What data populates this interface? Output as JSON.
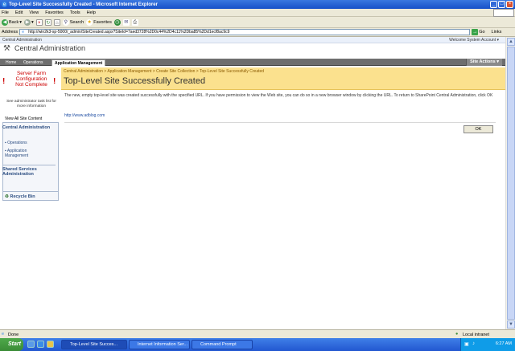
{
  "window": {
    "title": "Top-Level Site Successfully Created - Microsoft Internet Explorer"
  },
  "menu": [
    "File",
    "Edit",
    "View",
    "Favorites",
    "Tools",
    "Help"
  ],
  "toolbar": {
    "back_label": "Back",
    "search_label": "Search",
    "favorites_label": "Favorites"
  },
  "address": {
    "label": "Address",
    "value": "http://win2k3-sp-5000/_admin/SiteCreated.aspx?SiteId=7aed3728%2D0c44%2D4c11%2Dba85%2Dd1ecf8ac9c9",
    "go_label": "Go",
    "links_label": "Links"
  },
  "sp": {
    "topbar_label": "Central Administration",
    "welcome": "Welcome System Account ▾",
    "site_name": "Central Administration",
    "tabs": [
      "Home",
      "Operations",
      "Application Management"
    ],
    "site_actions": "Site Actions ▾"
  },
  "leftnav": {
    "warning_lines": [
      "Server Farm",
      "Configuration",
      "Not Complete"
    ],
    "see_text": "See administrator task list for more information",
    "view_all": "View All Site Content",
    "central_admin_head": "Central Administration",
    "items": [
      "Operations",
      "Application Management"
    ],
    "shared_services_head": "Shared Services Administration",
    "recycle_bin": "Recycle Bin"
  },
  "content": {
    "breadcrumb": "Central Administration > Application Management > Create Site Collection > Top-Level Site Successfully Created",
    "title": "Top-Level Site Successfully Created",
    "body": "The new, empty top-level site was created successfully with the specified URL. If you have permission to view the Web site, you can do so in a new browser window by clicking the URL. To return to SharePoint Central Administration, click OK",
    "url": "http://www.adblog.com",
    "ok_label": "OK"
  },
  "status": {
    "text": "Done",
    "zone": "Local intranet"
  },
  "taskbar": {
    "start": "Start",
    "tasks": [
      "Top-Level Site Succes...",
      "Internet Information Ser...",
      "Command Prompt"
    ],
    "clock": "6:27 AM"
  }
}
